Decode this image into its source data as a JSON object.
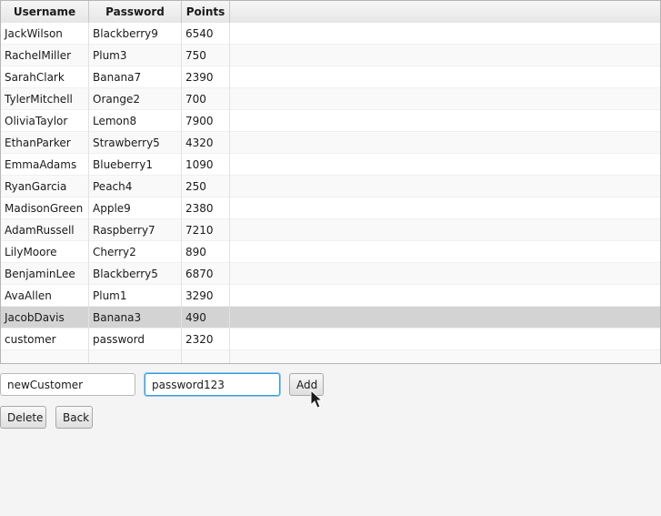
{
  "table": {
    "columns": [
      "Username",
      "Password",
      "Points"
    ],
    "rows": [
      [
        "JackWilson",
        "Blackberry9",
        "6540"
      ],
      [
        "RachelMiller",
        "Plum3",
        "750"
      ],
      [
        "SarahClark",
        "Banana7",
        "2390"
      ],
      [
        "TylerMitchell",
        "Orange2",
        "700"
      ],
      [
        "OliviaTaylor",
        "Lemon8",
        "7900"
      ],
      [
        "EthanParker",
        "Strawberry5",
        "4320"
      ],
      [
        "EmmaAdams",
        "Blueberry1",
        "1090"
      ],
      [
        "RyanGarcia",
        "Peach4",
        "250"
      ],
      [
        "MadisonGreen",
        "Apple9",
        "2380"
      ],
      [
        "AdamRussell",
        "Raspberry7",
        "7210"
      ],
      [
        "LilyMoore",
        "Cherry2",
        "890"
      ],
      [
        "BenjaminLee",
        "Blackberry5",
        "6870"
      ],
      [
        "AvaAllen",
        "Plum1",
        "3290"
      ],
      [
        "JacobDavis",
        "Banana3",
        "490"
      ],
      [
        "customer",
        "password",
        "2320"
      ]
    ],
    "selected_row": 13
  },
  "form": {
    "username_value": "newCustomer",
    "password_value": "password123",
    "add_label": "Add",
    "delete_label": "Delete",
    "back_label": "Back"
  },
  "colors": {
    "selected_row": "#d3d3d3",
    "focus_border": "#3c9bd8"
  },
  "icons": {
    "cursor": "mouse-pointer-icon"
  }
}
